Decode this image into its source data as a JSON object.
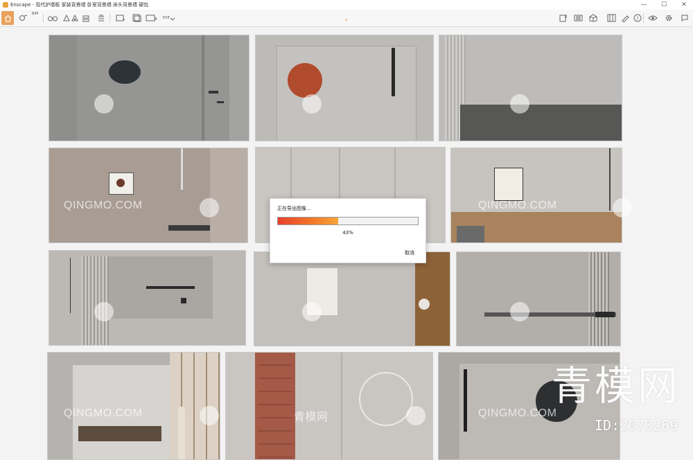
{
  "window": {
    "title": "Enscape - 现代护墙板 家装背景墙 卧室背景墙 床头背景墙 硬包",
    "minimize_glyph": "—",
    "maximize_glyph": "☐",
    "close_glyph": "✕"
  },
  "toolbar": {
    "bim_label": "BIM",
    "exe_label": "EXE",
    "left_icons": [
      "home-icon",
      "settings-link-icon",
      "bim-icon",
      "binoculars-icon",
      "stretch-icon",
      "sun-icon",
      "building-icon",
      "panel-icon",
      "screenshot-icon",
      "batch-render-icon",
      "panorama-icon",
      "export-icon"
    ],
    "right_icons": [
      "asset-library-icon",
      "material-icon",
      "cube-icon",
      "views-icon",
      "draw-icon",
      "help-icon",
      "visibility-icon",
      "settings-icon",
      "feedback-icon"
    ],
    "collapse_caret": "⌃"
  },
  "watermarks": {
    "brand_latin": "QINGMO.COM",
    "brand_cn_small": "青模网",
    "brand_cn_large": "青模网",
    "asset_id": "ID:2073269"
  },
  "export_dialog": {
    "title": "正在导出图像...",
    "progress_fraction": 0.43,
    "progress_text": "43%",
    "cancel_label": "取消"
  },
  "colors": {
    "accent": "#e9a15a",
    "progress_start": "#e8402b",
    "progress_end": "#f8a53a"
  }
}
